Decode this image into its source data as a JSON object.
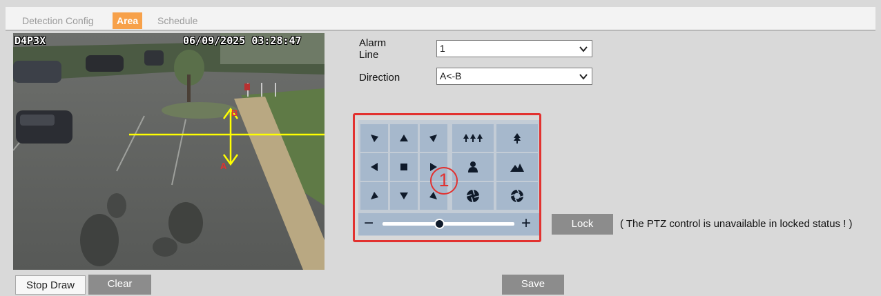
{
  "tabs": [
    {
      "label": "Detection Config"
    },
    {
      "label": "Area"
    },
    {
      "label": "Schedule"
    }
  ],
  "active_tab": "Area",
  "video": {
    "osd_left": "D4P3X",
    "osd_datetime": "06/09/2025 03:28:47",
    "line_label_a": "A"
  },
  "buttons": {
    "stop_draw": "Stop Draw",
    "clear": "Clear",
    "save": "Save",
    "lock": "Lock"
  },
  "form": {
    "alarm_line_label": "Alarm Line",
    "alarm_line_value": "1",
    "direction_label": "Direction",
    "direction_value": "A<-B"
  },
  "ptz": {
    "zoom_minus": "−",
    "zoom_plus": "+",
    "zoom_level": 0.43,
    "annotation_marker": "1",
    "icons": [
      "arrow-up-left-icon",
      "arrow-up-icon",
      "arrow-up-right-icon",
      "zoom-out-trees-icon",
      "zoom-in-tree-icon",
      "arrow-left-icon",
      "stop-icon",
      "arrow-right-icon",
      "focus-near-person-icon",
      "focus-far-mountain-icon",
      "arrow-down-left-icon",
      "arrow-down-icon",
      "arrow-down-right-icon",
      "iris-close-icon",
      "iris-open-icon"
    ]
  },
  "lock_note": "( The PTZ control is unavailable in locked status ! )",
  "colors": {
    "active_tab": "#f7a14a",
    "ptz_highlight": "#e2312f",
    "ptz_button": "#a6b8cc",
    "alarm_line": "#ffff00"
  }
}
